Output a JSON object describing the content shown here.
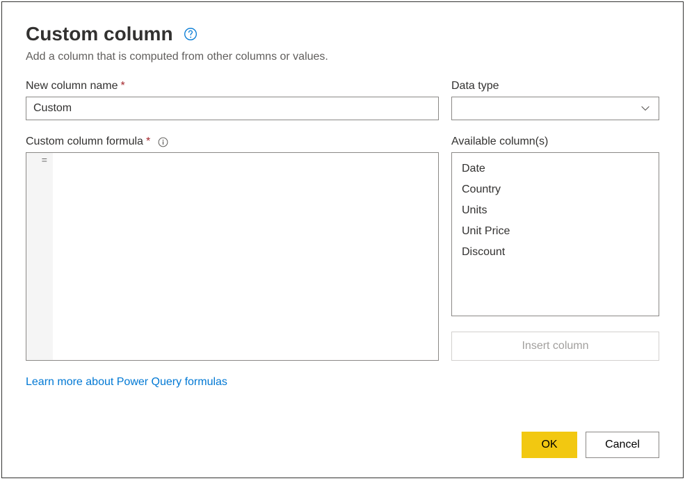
{
  "header": {
    "title": "Custom column",
    "description": "Add a column that is computed from other columns or values."
  },
  "labels": {
    "new_column_name": "New column name",
    "data_type": "Data type",
    "custom_column_formula": "Custom column formula",
    "available_columns": "Available column(s)",
    "required_mark": "*"
  },
  "fields": {
    "column_name_value": "Custom",
    "data_type_value": "",
    "formula_prefix": "="
  },
  "available_columns": [
    "Date",
    "Country",
    "Units",
    "Unit Price",
    "Discount"
  ],
  "buttons": {
    "insert_column": "Insert column",
    "ok": "OK",
    "cancel": "Cancel"
  },
  "links": {
    "learn_more": "Learn more about Power Query formulas"
  }
}
